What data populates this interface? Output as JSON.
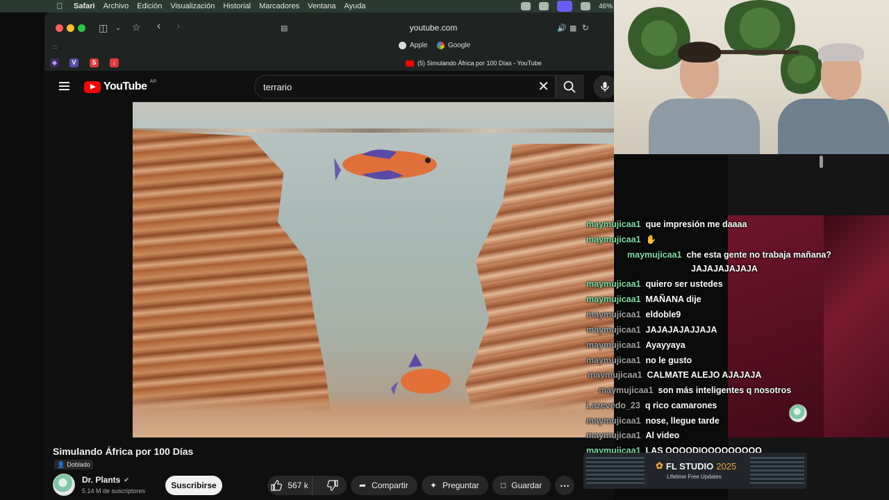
{
  "menubar": {
    "items": [
      "Safari",
      "Archivo",
      "Edición",
      "Visualización",
      "Historial",
      "Marcadores",
      "Ventana",
      "Ayuda"
    ],
    "battery": "46%"
  },
  "browser": {
    "url": "youtube.com",
    "favorites": [
      "Apple",
      "Google"
    ],
    "tab_title": "(5) Simulando África por 100 Días - YouTube",
    "extensions": [
      "V",
      "S"
    ]
  },
  "youtube": {
    "logo": "YouTube",
    "country": "AR",
    "search_value": "terrario",
    "video": {
      "title": "Simulando África por 100 Días",
      "badge": "Doblado",
      "channel": "Dr. Plants",
      "subscribers": "5.14 M de suscriptores",
      "subscribe_label": "Suscribirse",
      "likes": "567 k",
      "share_label": "Compartir",
      "ask_label": "Preguntar",
      "save_label": "Guardar"
    }
  },
  "chat": {
    "messages": [
      {
        "user": "maymujicaa1",
        "text": "que impresión me daaaa"
      },
      {
        "user": "maymujicaa1",
        "text": ""
      },
      {
        "user": "maymujicaa1",
        "text": "che esta gente no trabaja mañana?"
      },
      {
        "user": "",
        "text": "JAJAJAJAJAJA"
      },
      {
        "user": "maymujicaa1",
        "text": "quiero ser ustedes"
      },
      {
        "user": "maymujicaa1",
        "text": "MAÑANA dije"
      },
      {
        "user": "maymujicaa1",
        "text": "eldoble9"
      },
      {
        "user": "maymujicaa1",
        "text": "JAJAJAJAJJAJA"
      },
      {
        "user": "maymujicaa1",
        "text": "Ayayyaya"
      },
      {
        "user": "maymujicaa1",
        "text": "no le gusto"
      },
      {
        "user": "maymujicaa1",
        "text": "CALMATE ALEJO AJAJAJA"
      },
      {
        "user": "maymujicaa1",
        "text": "son más inteligentes q nosotros"
      },
      {
        "user": "Lazevedo_23",
        "text": "q rico camarones"
      },
      {
        "user": "maymujicaa1",
        "text": "nose, llegue tarde"
      },
      {
        "user": "maymujicaa1",
        "text": "Al video"
      },
      {
        "user": "maymujicaa1",
        "text": "LAS OOOODIOOOOOOOOO"
      }
    ]
  },
  "ad": {
    "title": "FL STUDIO",
    "year": "2025",
    "subtitle": "Lifetime Free Updates"
  },
  "colors": {
    "youtube_red": "#ff0000",
    "chat_username": "#7fe0a6",
    "background": "#0f0f0f"
  }
}
